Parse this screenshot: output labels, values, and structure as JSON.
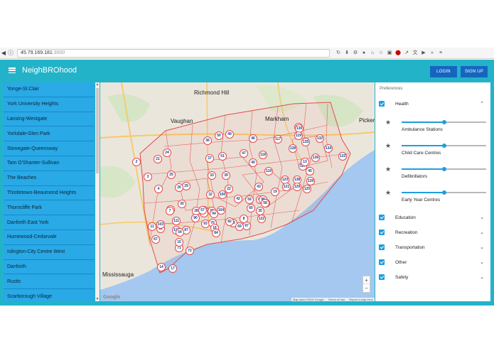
{
  "browser": {
    "url_host": "45.79.169.181",
    "url_port": ":3000",
    "back_icon": "back-arrow-icon",
    "forward_icon": "forward-arrow-icon"
  },
  "app": {
    "title": "NeighBROhood",
    "login_label": "LOGIN",
    "signup_label": "SIGN UP",
    "accent_color": "#22b3c9",
    "button_color": "#1565c0"
  },
  "sidebar": {
    "items": [
      "Yonge-St.Clair",
      "York University Heights",
      "Lansing-Westgate",
      "Yorkdale-Glen Park",
      "Stonegate-Queensway",
      "Tam O'Shanter-Sullivan",
      "The Beaches",
      "Thistletown-Beaumond Heights",
      "Thorncliffe Park",
      "Danforth East York",
      "Humewood-Cedarvale",
      "Islington-City Centre West",
      "Danforth",
      "Rustic",
      "Scarborough Village"
    ]
  },
  "map": {
    "labels": {
      "richmond_hill": "Richmond Hill",
      "vaughan": "Vaughan",
      "markham": "Markham",
      "pickering": "Pickeri",
      "mississauga": "Mississauga"
    },
    "markers": [
      "116",
      "130",
      "49",
      "119",
      "132",
      "36",
      "50",
      "46",
      "117",
      "128",
      "24",
      "135",
      "134",
      "133",
      "21",
      "2",
      "37",
      "51",
      "47",
      "118",
      "136",
      "127",
      "40",
      "3",
      "25",
      "33",
      "39",
      "119",
      "123",
      "138",
      "29",
      "26",
      "43",
      "139",
      "4",
      "22",
      "59",
      "42",
      "120",
      "121",
      "32",
      "100",
      "125",
      "28",
      "30",
      "104",
      "107",
      "60",
      "61",
      "98",
      "5",
      "7",
      "35",
      "62",
      "58",
      "11",
      "111",
      "115",
      "87",
      "93",
      "90",
      "70",
      "73",
      "76",
      "94",
      "97",
      "67",
      "12",
      "16",
      "84",
      "82",
      "69",
      "71",
      "72",
      "14",
      "17",
      "20",
      "19",
      "103",
      "122",
      "8",
      "57",
      "54",
      "15",
      "13",
      "45"
    ],
    "zoom_in": "+",
    "zoom_out": "−",
    "google_label": "Google",
    "attribution": [
      "Map data ©2016 Google",
      "Terms of Use",
      "Report a map error"
    ]
  },
  "preferences": {
    "title": "Preferences",
    "categories": [
      {
        "label": "Health",
        "checked": true,
        "expanded": true
      },
      {
        "label": "Education",
        "checked": true,
        "expanded": false
      },
      {
        "label": "Recreation",
        "checked": true,
        "expanded": false
      },
      {
        "label": "Transportation",
        "checked": true,
        "expanded": false
      },
      {
        "label": "Other",
        "checked": true,
        "expanded": false
      },
      {
        "label": "Safety",
        "checked": true,
        "expanded": false
      }
    ],
    "health_items": [
      {
        "label": "Ambulance Stations",
        "value": 0.5
      },
      {
        "label": "Child Care Centres",
        "value": 0.5
      },
      {
        "label": "Defibrillators",
        "value": 0.5
      },
      {
        "label": "Early Year Centres",
        "value": 0.5
      }
    ]
  }
}
